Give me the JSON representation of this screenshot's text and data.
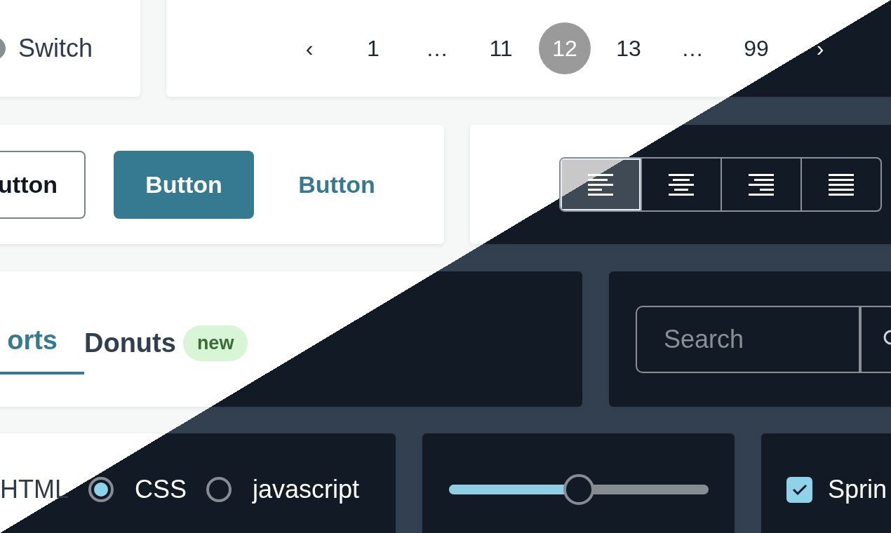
{
  "switch": {
    "label": "Switch",
    "on": false
  },
  "pagination": {
    "items": [
      {
        "label": "‹",
        "selected": false
      },
      {
        "label": "1",
        "selected": false
      },
      {
        "label": "…",
        "selected": false
      },
      {
        "label": "11",
        "selected": false
      },
      {
        "label": "12",
        "selected": true
      },
      {
        "label": "13",
        "selected": false
      },
      {
        "label": "…",
        "selected": false
      },
      {
        "label": "99",
        "selected": false
      },
      {
        "label": "›",
        "selected": false
      }
    ]
  },
  "buttons": [
    {
      "kind": "outline",
      "label": "utton"
    },
    {
      "kind": "filled",
      "label": "Button"
    },
    {
      "kind": "text",
      "label": "Button"
    }
  ],
  "alignment": [
    {
      "kind": "left",
      "selected": true
    },
    {
      "kind": "center",
      "selected": false
    },
    {
      "kind": "right",
      "selected": false
    },
    {
      "kind": "justify",
      "selected": false
    }
  ],
  "tabs": [
    {
      "label": "orts",
      "selected": true
    },
    {
      "label": "Donuts",
      "selected": false,
      "badge": "new"
    }
  ],
  "search": {
    "placeholder": "Search"
  },
  "radios": [
    {
      "label": "HTML"
    },
    {
      "label": "CSS",
      "selected": true
    },
    {
      "label": "javascript",
      "selected": false
    }
  ],
  "slider": {
    "level": 0.5
  },
  "checkbox": {
    "label": "Sprin",
    "checked": true
  }
}
